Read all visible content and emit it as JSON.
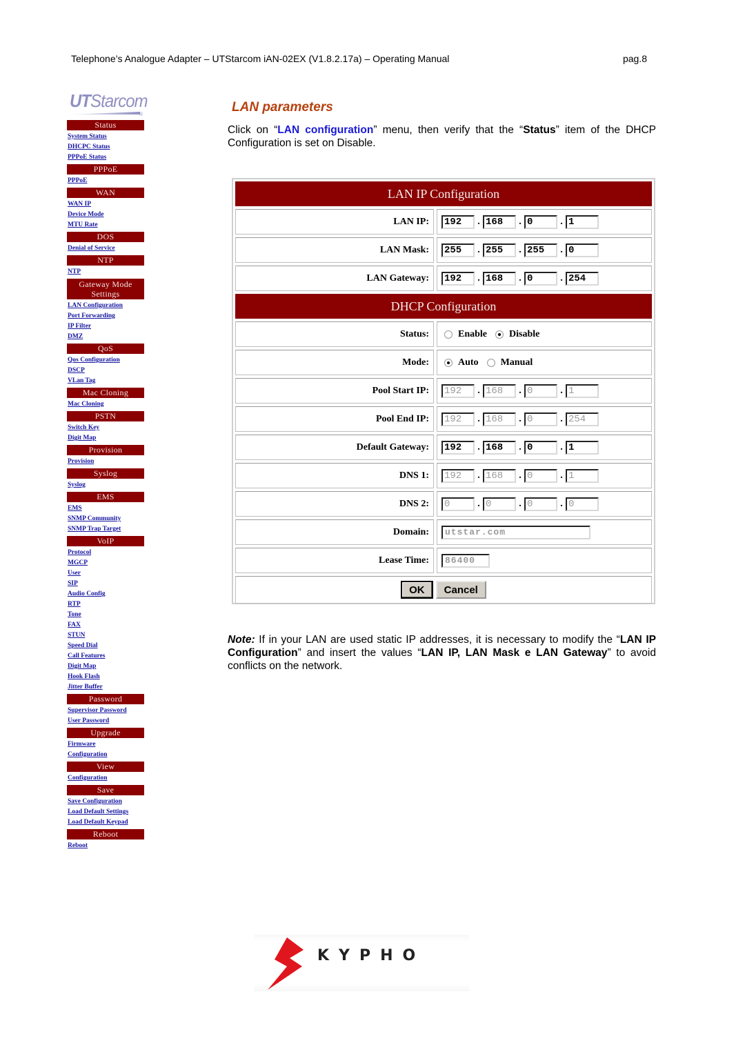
{
  "header": {
    "title": "Telephone’s Analogue Adapter  –  UTStarcom iAN-02EX (V1.8.2.17a) – Operating Manual",
    "page": "pag.8"
  },
  "sidebar": {
    "logo": {
      "bold": "UT",
      "light": "Starcom",
      "reg": "®"
    },
    "groups": [
      {
        "title": "Status",
        "links": [
          "System Status",
          "DHCPC Status",
          "PPPoE Status"
        ]
      },
      {
        "title": "PPPoE",
        "links": [
          "PPPoE"
        ]
      },
      {
        "title": "WAN",
        "links": [
          "WAN IP",
          "Device Mode",
          "MTU Rate"
        ]
      },
      {
        "title": "DOS",
        "links": [
          "Denial of Service"
        ]
      },
      {
        "title": "NTP",
        "links": [
          "NTP"
        ]
      },
      {
        "title": "Gateway Mode Settings",
        "links": [
          "LAN Configuration",
          "Port Forwarding",
          "IP Filter",
          "DMZ"
        ]
      },
      {
        "title": "QoS",
        "links": [
          "Qos Configuration",
          "DSCP",
          "VLan Tag"
        ]
      },
      {
        "title": "Mac Cloning",
        "links": [
          "Mac Cloning"
        ]
      },
      {
        "title": "PSTN",
        "links": [
          "Switch Key",
          "Digit Map"
        ]
      },
      {
        "title": "Provision",
        "links": [
          "Provision"
        ]
      },
      {
        "title": "Syslog",
        "links": [
          "Syslog"
        ]
      },
      {
        "title": "EMS",
        "links": [
          "EMS",
          "SNMP Community",
          "SNMP Trap Target"
        ]
      },
      {
        "title": "VoIP",
        "links": [
          "Protocol",
          "MGCP",
          "User",
          "SIP",
          "Audio Config",
          "RTP",
          "Tone",
          "FAX",
          "STUN",
          "Speed Dial",
          "Call Features",
          "Digit Map",
          "Hook Flash",
          "Jitter Buffer"
        ]
      },
      {
        "title": "Password",
        "links": [
          "Supervisor Password",
          "User Password"
        ]
      },
      {
        "title": "Upgrade",
        "links": [
          "Firmware",
          "Configuration"
        ]
      },
      {
        "title": "View",
        "links": [
          "Configuration"
        ]
      },
      {
        "title": "Save",
        "links": [
          "Save Configuration",
          "Load Default Settings",
          "Load Default Keypad"
        ]
      },
      {
        "title": "Reboot",
        "links": [
          "Reboot"
        ]
      }
    ]
  },
  "main": {
    "section_title": "LAN parameters",
    "intro": {
      "part1": "Click on “",
      "link": "LAN configuration",
      "part2": "” menu, then verify that the “",
      "bold": "Status",
      "part3": "” item of the DHCP Configuration is set on Disable."
    },
    "note": {
      "label": "Note:",
      "part1": " If in your LAN are used static IP addresses, it is necessary to modify the “",
      "bold1": "LAN IP Configuration",
      "part2": "” and insert the values “",
      "bold2": "LAN IP, LAN Mask e LAN Gateway",
      "part3": "” to avoid conflicts on the network."
    }
  },
  "panel": {
    "lan_title": "LAN IP Configuration",
    "dhcp_title": "DHCP Configuration",
    "lan_ip": {
      "label": "LAN IP:",
      "octets": [
        "192",
        "168",
        "0",
        "1"
      ]
    },
    "lan_mask": {
      "label": "LAN Mask:",
      "octets": [
        "255",
        "255",
        "255",
        "0"
      ]
    },
    "lan_gateway": {
      "label": "LAN Gateway:",
      "octets": [
        "192",
        "168",
        "0",
        "254"
      ]
    },
    "status": {
      "label": "Status:",
      "options": [
        "Enable",
        "Disable"
      ],
      "selected": "Disable"
    },
    "mode": {
      "label": "Mode:",
      "options": [
        "Auto",
        "Manual"
      ],
      "selected": "Auto"
    },
    "pool_start": {
      "label": "Pool Start IP:",
      "octets": [
        "192",
        "168",
        "0",
        "1"
      ]
    },
    "pool_end": {
      "label": "Pool End IP:",
      "octets": [
        "192",
        "168",
        "0",
        "254"
      ]
    },
    "default_gateway": {
      "label": "Default Gateway:",
      "octets": [
        "192",
        "168",
        "0",
        "1"
      ]
    },
    "dns1": {
      "label": "DNS 1:",
      "octets": [
        "192",
        "168",
        "0",
        "1"
      ]
    },
    "dns2": {
      "label": "DNS 2:",
      "octets": [
        "0",
        "0",
        "0",
        "0"
      ]
    },
    "domain": {
      "label": "Domain:",
      "value": "utstar.com"
    },
    "lease_time": {
      "label": "Lease Time:",
      "value": "86400"
    },
    "ok_label": "OK",
    "cancel_label": "Cancel"
  },
  "footer": {
    "brand": "KYPHO"
  },
  "colors": {
    "menu_header": "#8b0000",
    "link": "#1414a0",
    "section_title": "#b5420f",
    "brand_red": "#e0161e"
  }
}
